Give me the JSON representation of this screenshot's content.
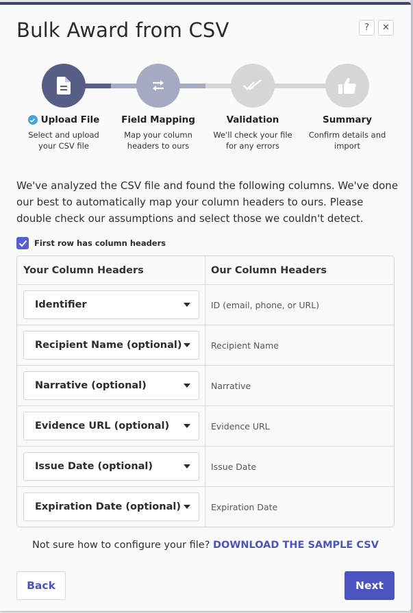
{
  "modal": {
    "title": "Bulk Award from CSV",
    "help_label": "?",
    "close_label": "✕"
  },
  "stepper": {
    "current_step": 2,
    "steps": [
      {
        "title": "Upload File",
        "description_line1": "Select and upload",
        "description_line2": "your CSV file",
        "icon": "document-icon",
        "status": "complete"
      },
      {
        "title": "Field Mapping",
        "description_line1": "Map your column",
        "description_line2": "headers to ours",
        "icon": "exchange-arrows-icon",
        "status": "active"
      },
      {
        "title": "Validation",
        "description_line1": "We'll check your file",
        "description_line2": "for any errors",
        "icon": "double-check-icon",
        "status": "pending"
      },
      {
        "title": "Summary",
        "description_line1": "Confirm details and",
        "description_line2": "import",
        "icon": "thumbs-up-icon",
        "status": "pending"
      }
    ],
    "colors": {
      "complete": "#575f86",
      "active": "#a5a9c1",
      "pending": "#d6d6d6"
    }
  },
  "intro_text": "We've analyzed the CSV file and found the following columns. We've done our best to automatically map your column headers to ours. Please double check our assumptions and select those we couldn't detect.",
  "first_row_headers": {
    "label": "First row has column headers",
    "checked": true
  },
  "mapping_table": {
    "headers": {
      "yours": "Your Column Headers",
      "ours": "Our Column Headers"
    },
    "rows": [
      {
        "selected": "Identifier",
        "ours": "ID (email, phone, or URL)"
      },
      {
        "selected": "Recipient Name (optional)",
        "ours": "Recipient Name"
      },
      {
        "selected": "Narrative (optional)",
        "ours": "Narrative"
      },
      {
        "selected": "Evidence URL (optional)",
        "ours": "Evidence URL"
      },
      {
        "selected": "Issue Date (optional)",
        "ours": "Issue Date"
      },
      {
        "selected": "Expiration Date (optional)",
        "ours": "Expiration Date"
      }
    ]
  },
  "sample": {
    "prompt": "Not sure how to configure your file?",
    "link_label": "DOWNLOAD THE SAMPLE CSV"
  },
  "footer": {
    "back_label": "Back",
    "next_label": "Next"
  },
  "colors": {
    "accent": "#4a53c0",
    "header_bar": "#3f4573",
    "check_badge": "#41a3d9"
  }
}
